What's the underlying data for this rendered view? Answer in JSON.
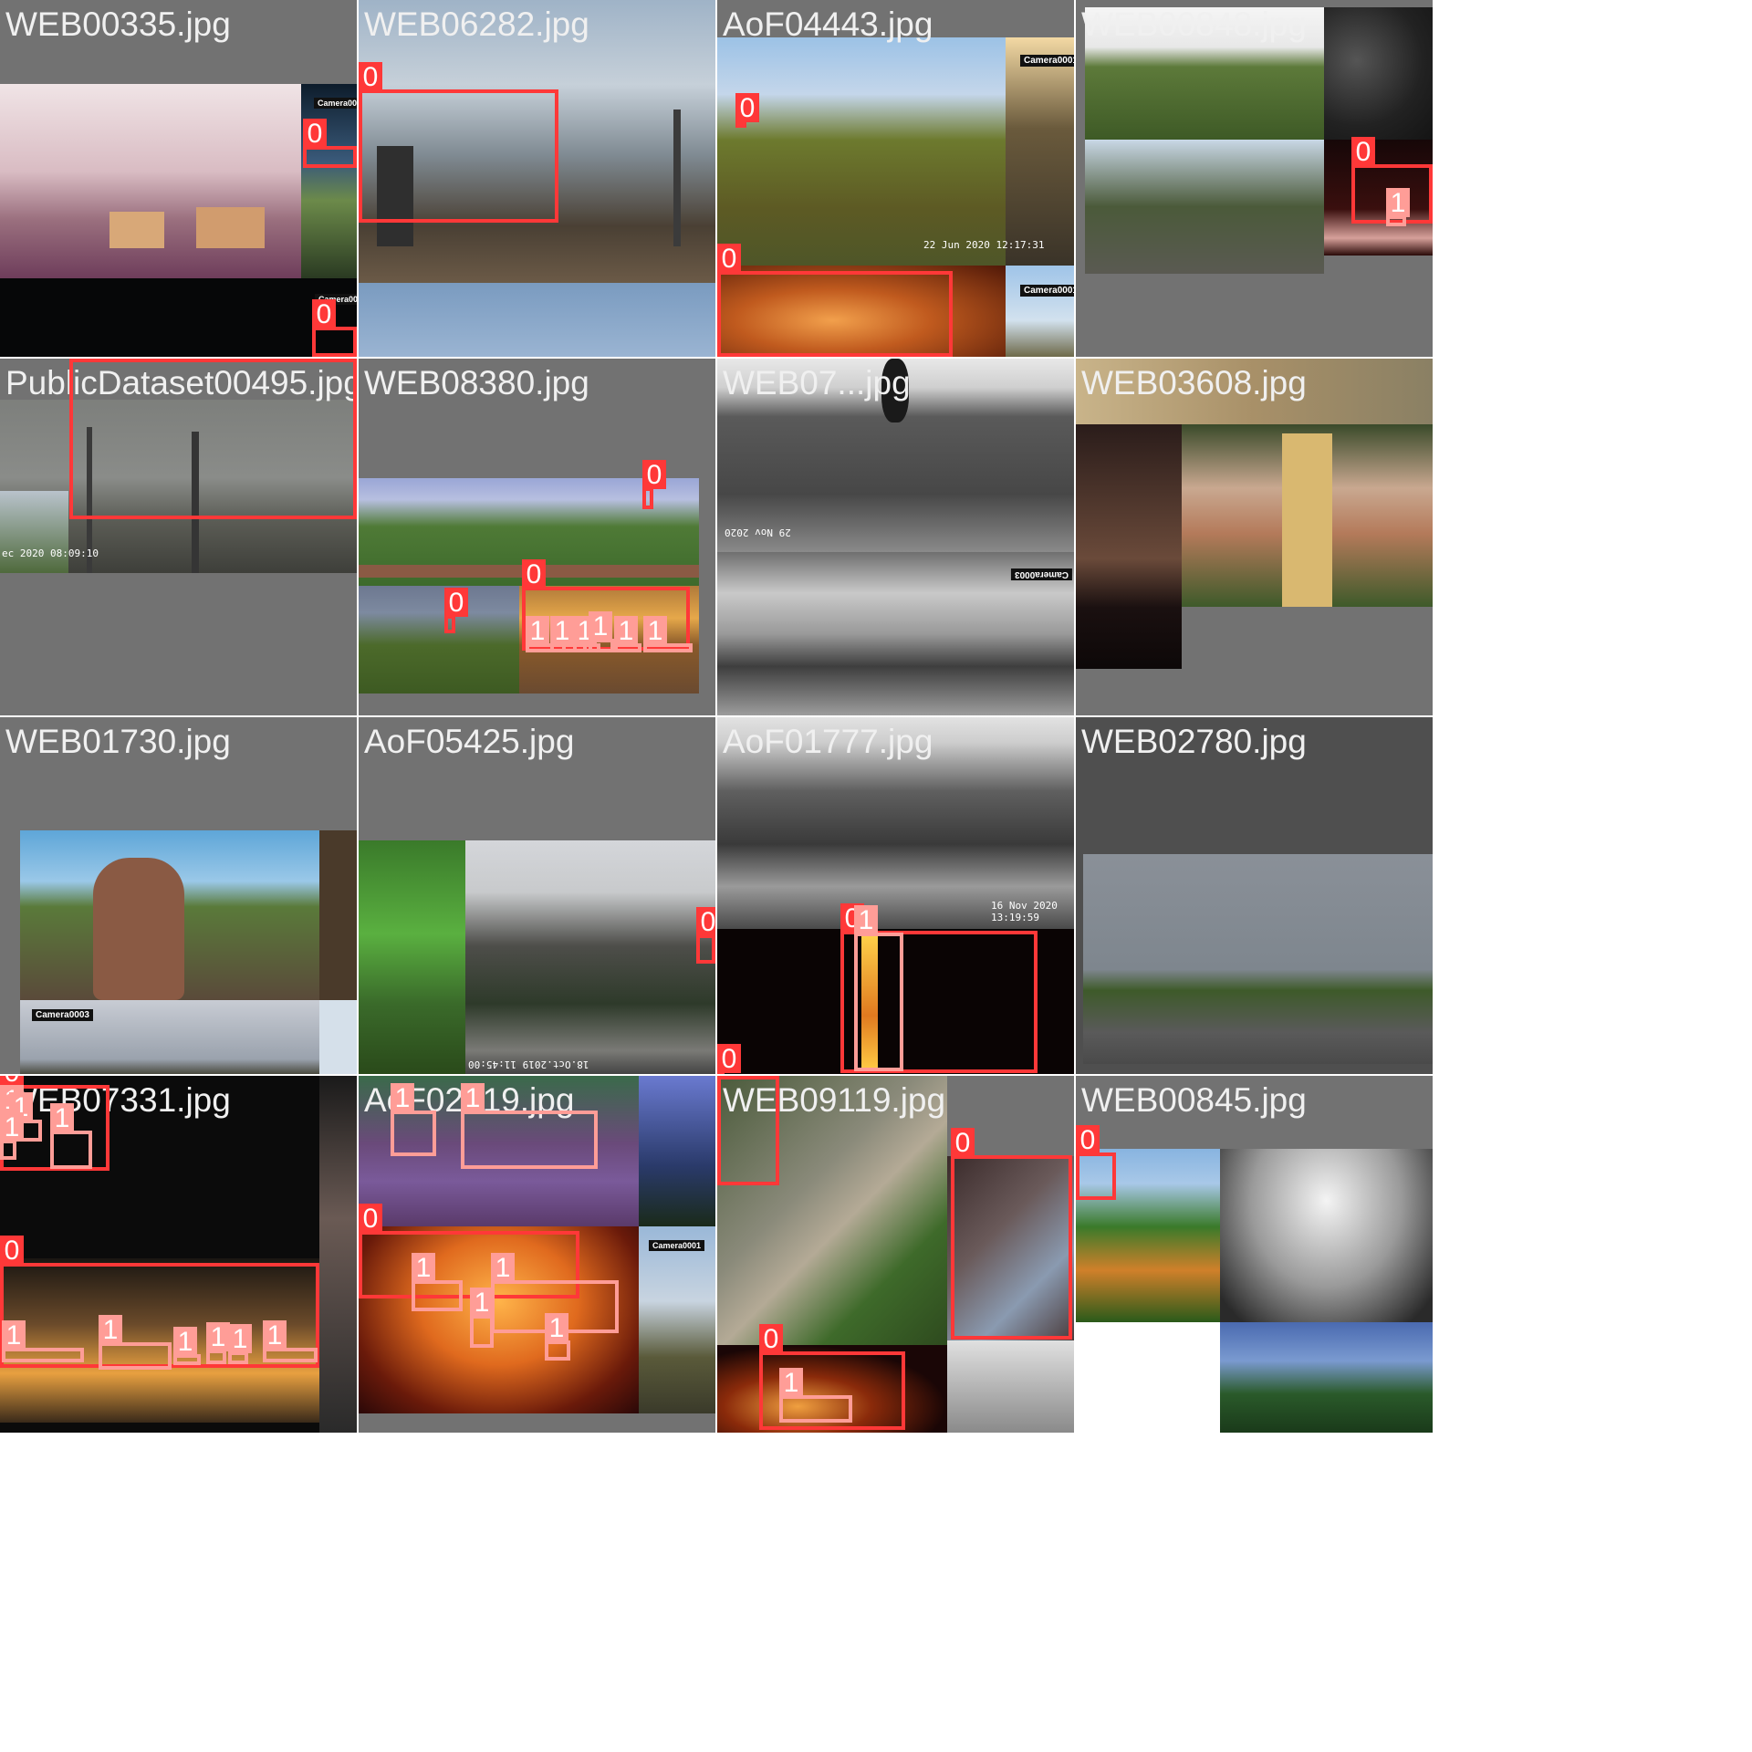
{
  "grid": {
    "rows": 4,
    "cols": 4,
    "background": "#ffffff"
  },
  "class_colors": {
    "0": "#ff3838",
    "1": "#ff9d97"
  },
  "tiles": [
    {
      "filename": "WEB00335.jpg"
    },
    {
      "filename": "WEB06282.jpg"
    },
    {
      "filename": "AoF04443.jpg"
    },
    {
      "filename": "WEB00848.jpg"
    },
    {
      "filename": "PublicDataset00495.jpg"
    },
    {
      "filename": "WEB08380.jpg"
    },
    {
      "filename": "WEB07...jpg"
    },
    {
      "filename": "WEB03608.jpg"
    },
    {
      "filename": "WEB01730.jpg"
    },
    {
      "filename": "AoF05425.jpg"
    },
    {
      "filename": "AoF01777.jpg"
    },
    {
      "filename": "WEB02780.jpg"
    },
    {
      "filename": "WEB07331.jpg"
    },
    {
      "filename": "AoF02019.jpg"
    },
    {
      "filename": "WEB09119.jpg"
    },
    {
      "filename": "WEB00845.jpg"
    }
  ],
  "overlay_text": {
    "camera": "Camera0001",
    "camera3": "Camera0003",
    "aof04443_stamp": "22 Jun 2020  12:17:31",
    "pd_stamp": "ec 2020  08:09:10",
    "aof05425_stamp": "18.Oct.2019  11:45:00",
    "aof01777_stamp": "16 Nov 2020  13:19:59",
    "w07_stamp": "29 Nov 2020"
  }
}
